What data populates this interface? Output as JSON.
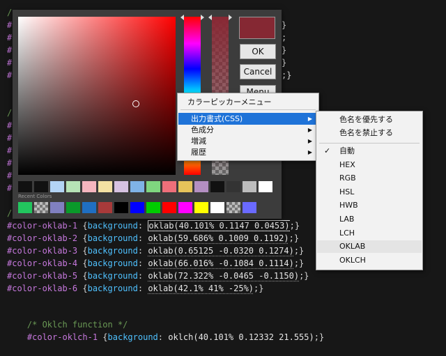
{
  "editor": {
    "peek_right": [
      "}",
      ";",
      "}",
      ";}",
      "}"
    ],
    "peek_left": [
      "/",
      "#",
      "#",
      "#",
      "#",
      "#",
      "/",
      "#",
      "#",
      "#",
      "#",
      "#",
      "#",
      "/"
    ],
    "rows": [
      {
        "sel": "#color-oklab-1",
        "prop": "background",
        "val": "oklab(40.101% 0.1147 0.0453)"
      },
      {
        "sel": "#color-oklab-2",
        "prop": "background",
        "val": "oklab(59.686% 0.1009 0.1192)"
      },
      {
        "sel": "#color-oklab-3",
        "prop": "background",
        "val": "oklab(0.65125 -0.0320 0.1274)"
      },
      {
        "sel": "#color-oklab-4",
        "prop": "background",
        "val": "oklab(66.016% -0.1084 0.1114)"
      },
      {
        "sel": "#color-oklab-5",
        "prop": "background",
        "val": "oklab(72.322% -0.0465 -0.1150)"
      },
      {
        "sel": "#color-oklab-6",
        "prop": "background",
        "val": "oklab(42.1% 41% -25%)"
      }
    ],
    "comment": "/* Oklch function */",
    "last_row": {
      "sel": "#color-oklch-1",
      "prop": "background",
      "val": "oklch(40.101% 0.12332 21.555)"
    }
  },
  "picker": {
    "current_color": "#852833",
    "ok_label": "OK",
    "cancel_label": "Cancel",
    "menu_label": "Menu",
    "recent_label": "Recent Colors",
    "palette": [
      "#111111",
      "#111111",
      "#b3d4f5",
      "#b6e3b6",
      "#f5b6bf",
      "#f3e1a3",
      "#d6c2e1",
      "#7fb3e6",
      "#7fd67f",
      "#ee6f7a",
      "#e6c35a",
      "#b48fc2",
      "#111111",
      "#333333",
      "#bdbdbd",
      "#ffffff"
    ],
    "recent": [
      "#22c55e",
      "checker",
      "#8080c0",
      "#0a9a2a",
      "#1f6fc2",
      "#a83a3a",
      "#000000",
      "#0000ff",
      "#00cc00",
      "#ff0000",
      "#ff00ff",
      "#ffff00",
      "#ffffff",
      "checker",
      "#6a6aff"
    ]
  },
  "context_menu": {
    "title": "カラーピッカーメニュー",
    "items": [
      {
        "label": "出力書式(CSS)",
        "highlighted": true
      },
      {
        "label": "色成分",
        "highlighted": false
      },
      {
        "label": "増減",
        "highlighted": false
      },
      {
        "label": "履歴",
        "highlighted": false
      }
    ]
  },
  "submenu": {
    "top_items": [
      "色名を優先する",
      "色名を禁止する"
    ],
    "formats": [
      {
        "label": "自動",
        "checked": true
      },
      {
        "label": "HEX",
        "checked": false
      },
      {
        "label": "RGB",
        "checked": false
      },
      {
        "label": "HSL",
        "checked": false
      },
      {
        "label": "HWB",
        "checked": false
      },
      {
        "label": "LAB",
        "checked": false
      },
      {
        "label": "LCH",
        "checked": false
      },
      {
        "label": "OKLAB",
        "checked": false
      },
      {
        "label": "OKLCH",
        "checked": false
      }
    ],
    "hovered": "OKLAB",
    "check_glyph": "✓"
  }
}
